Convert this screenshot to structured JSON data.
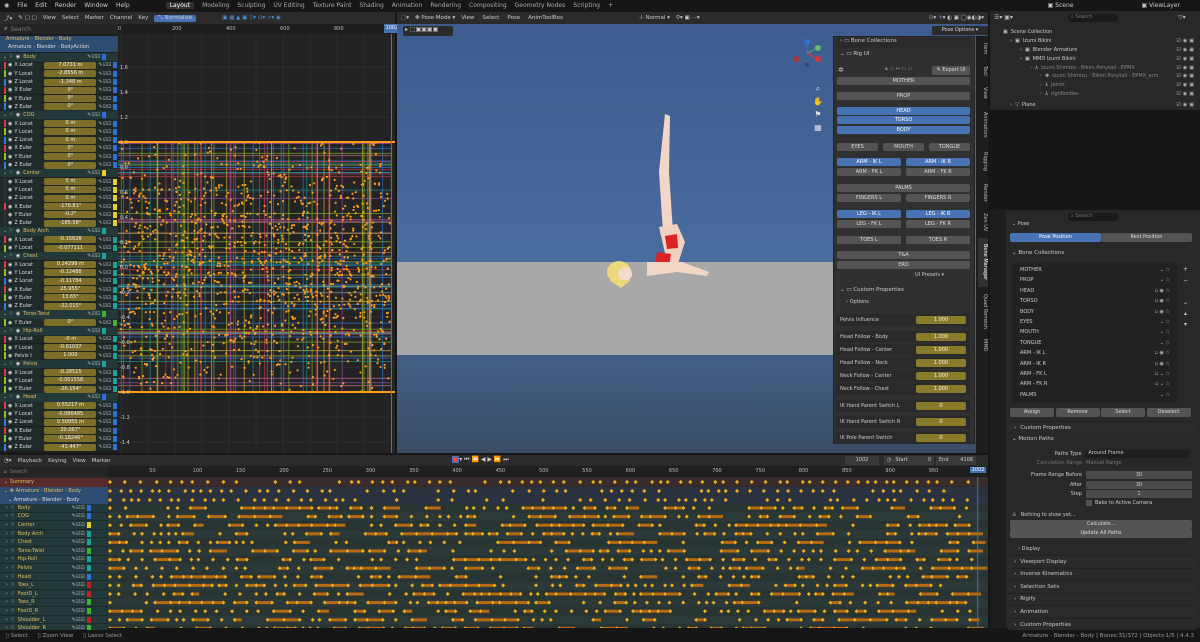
{
  "topbar": {
    "menus": [
      "File",
      "Edit",
      "Render",
      "Window",
      "Help"
    ],
    "workspaces": [
      "Layout",
      "Modeling",
      "Sculpting",
      "UV Editing",
      "Texture Paint",
      "Shading",
      "Animation",
      "Rendering",
      "Compositing",
      "Geometry Nodes",
      "Scripting",
      "+"
    ],
    "active_workspace": "Layout",
    "scene": "Scene",
    "view_layer": "ViewLayer"
  },
  "graph": {
    "header": [
      "View",
      "Select",
      "Marker",
      "Channel",
      "Key"
    ],
    "normalize": "Normalize",
    "search_placeholder": "Search",
    "ruler": [
      "0",
      "200",
      "400",
      "600",
      "800"
    ],
    "current_frame": "1002",
    "yticks": [
      "1.6",
      "1.4",
      "1.2",
      "1.0",
      "0.8",
      "0.6",
      "0.4",
      "0.2",
      "0.0",
      "-0.2",
      "-0.4",
      "-0.6",
      "-0.8",
      "-1.0",
      "-1.2",
      "-1.4"
    ],
    "object": "Armature - Blender - Body",
    "action": "Armature - Blender - BodyAction",
    "channels": [
      {
        "g": "Body",
        "c": "#2f6fd8"
      },
      {
        "n": "X Locat",
        "v": "7.0731 m",
        "a": "x"
      },
      {
        "n": "Y Locat",
        "v": "-2.8556 m",
        "a": "y"
      },
      {
        "n": "Z Locat",
        "v": "-1.348 m",
        "a": "z"
      },
      {
        "n": "X Euler",
        "v": "0°",
        "a": "x"
      },
      {
        "n": "Y Euler",
        "v": "0°",
        "a": "y"
      },
      {
        "n": "Z Euler",
        "v": "0°",
        "a": "z"
      },
      {
        "g": "COG",
        "c": "#2f6fd8"
      },
      {
        "n": "X Locat",
        "v": "0 m",
        "a": "x"
      },
      {
        "n": "Y Locat",
        "v": "0 m",
        "a": "y"
      },
      {
        "n": "Z Locat",
        "v": "0 m",
        "a": "z"
      },
      {
        "n": "X Euler",
        "v": "0°",
        "a": "x"
      },
      {
        "n": "Y Euler",
        "v": "0°",
        "a": "y"
      },
      {
        "n": "Z Euler",
        "v": "0°",
        "a": "z"
      },
      {
        "g": "Center",
        "c": "#e6cf2a"
      },
      {
        "n": "X Locat",
        "v": "0 m",
        "a": "d"
      },
      {
        "n": "Y Locat",
        "v": "0 m",
        "a": "d"
      },
      {
        "n": "Z Locat",
        "v": "0 m",
        "a": "d"
      },
      {
        "n": "X Euler",
        "v": "-178.81°",
        "a": "x"
      },
      {
        "n": "Y Euler",
        "v": "-0.2°",
        "a": "d"
      },
      {
        "n": "Z Euler",
        "v": "-185.58°",
        "a": "d"
      },
      {
        "g": "Body Arch",
        "c": "#1aa39a"
      },
      {
        "n": "X Locat",
        "v": "-0.15628",
        "a": "x"
      },
      {
        "n": "Y Locat",
        "v": "-0.077111",
        "a": "y"
      },
      {
        "g": "Chest",
        "c": "#1aa39a"
      },
      {
        "n": "X Locat",
        "v": "0.24299 m",
        "a": "x"
      },
      {
        "n": "Y Locat",
        "v": "-0.12488",
        "a": "y"
      },
      {
        "n": "Z Locat",
        "v": "-0.11784",
        "a": "z"
      },
      {
        "n": "X Euler",
        "v": "25.955°",
        "a": "x"
      },
      {
        "n": "Y Euler",
        "v": "13.65°",
        "a": "y"
      },
      {
        "n": "Z Euler",
        "v": "-22.015°",
        "a": "z"
      },
      {
        "g": "Torso-Twist",
        "c": "#3cb52a"
      },
      {
        "n": "Y Euler",
        "v": "0°",
        "a": "y"
      },
      {
        "g": "Hip-Roll",
        "c": "#1aa39a"
      },
      {
        "n": "X Locat",
        "v": "-0 m",
        "a": "x"
      },
      {
        "n": "Y Locat",
        "v": "-0.61037",
        "a": "y"
      },
      {
        "n": "Pelvis I",
        "v": "1.000",
        "a": "y"
      },
      {
        "g": "Pelvis",
        "c": "#1aa39a"
      },
      {
        "n": "X Locat",
        "v": "-0.28515",
        "a": "x"
      },
      {
        "n": "Y Locat",
        "v": "-0.001558",
        "a": "y"
      },
      {
        "n": "Y Euler",
        "v": "-26.154°",
        "a": "y"
      },
      {
        "g": "Head",
        "c": "#2f6fd8"
      },
      {
        "n": "X Locat",
        "v": "0.55217 m",
        "a": "x"
      },
      {
        "n": "Y Locat",
        "v": "-0.086485",
        "a": "y"
      },
      {
        "n": "Z Locat",
        "v": "0.50955 m",
        "a": "z"
      },
      {
        "n": "X Euler",
        "v": "20.067°",
        "a": "x"
      },
      {
        "n": "Y Euler",
        "v": "-0.18246°",
        "a": "y"
      },
      {
        "n": "Z Euler",
        "v": "-41.447°",
        "a": "z"
      }
    ]
  },
  "viewport": {
    "mode": "Pose Mode",
    "menus": [
      "View",
      "Select",
      "Pose",
      "AnimToolBox"
    ],
    "orientation": "Normal",
    "pose_options": "Pose Options",
    "tabs": [
      "Item",
      "Tool",
      "View",
      "Animation",
      "Rigging",
      "Render",
      "Zen UV",
      "Bone Manager",
      "Quad Remesh",
      "MMD"
    ],
    "sidebar": {
      "bone_collections": "Bone Collections",
      "rig_ui": "Rig UI",
      "export": "Export UI",
      "ui_presets": "UI Presets",
      "buttons": [
        {
          "l": "MOTHER",
          "on": false,
          "row": 0,
          "col": "full"
        },
        {
          "l": "PROP",
          "on": false,
          "row": 1,
          "col": "full"
        },
        {
          "l": "HEAD",
          "on": true,
          "row": 2,
          "col": "full"
        },
        {
          "l": "TORSO",
          "on": true,
          "row": 3,
          "col": "full"
        },
        {
          "l": "BODY",
          "on": true,
          "row": 4,
          "col": "full"
        },
        {
          "l": "EYES",
          "on": false,
          "row": 5,
          "col": "t1"
        },
        {
          "l": "MOUTH",
          "on": false,
          "row": 5,
          "col": "t2"
        },
        {
          "l": "TONGUE",
          "on": false,
          "row": 5,
          "col": "t3"
        },
        {
          "l": "ARM - IK L",
          "on": true,
          "row": 6,
          "col": "l"
        },
        {
          "l": "ARM - IK R",
          "on": true,
          "row": 6,
          "col": "r"
        },
        {
          "l": "ARM - FK L",
          "on": false,
          "row": 7,
          "col": "l"
        },
        {
          "l": "ARM - FK R",
          "on": false,
          "row": 7,
          "col": "r"
        },
        {
          "l": "PALMS",
          "on": false,
          "row": 8,
          "col": "full"
        },
        {
          "l": "FINGERS L",
          "on": false,
          "row": 9,
          "col": "l"
        },
        {
          "l": "FINGERS R",
          "on": false,
          "row": 9,
          "col": "r"
        },
        {
          "l": "LEG - IK L",
          "on": true,
          "row": 10,
          "col": "l"
        },
        {
          "l": "LEG - IK R",
          "on": true,
          "row": 10,
          "col": "r"
        },
        {
          "l": "LEG - FK L",
          "on": false,
          "row": 11,
          "col": "l"
        },
        {
          "l": "LEG - FK R",
          "on": false,
          "row": 11,
          "col": "r"
        },
        {
          "l": "TOES L",
          "on": false,
          "row": 12,
          "col": "l"
        },
        {
          "l": "TOES R",
          "on": false,
          "row": 12,
          "col": "r"
        },
        {
          "l": "T&A",
          "on": false,
          "row": 13,
          "col": "full"
        },
        {
          "l": "ERO",
          "on": false,
          "row": 14,
          "col": "full"
        }
      ],
      "custom_properties": "Custom Properties",
      "options": "Options",
      "props": [
        {
          "l": "Pelvis Influence",
          "v": "1.000"
        },
        {
          "l": "Head Follow - Body",
          "v": "1.000"
        },
        {
          "l": "Head Follow - Center",
          "v": "1.000"
        },
        {
          "l": "Head Follow - Neck",
          "v": "1.000"
        },
        {
          "l": "Neck Follow - Center",
          "v": "1.000"
        },
        {
          "l": "Neck Follow - Chest",
          "v": "1.000"
        },
        {
          "l": "IK Hand Parent Switch L",
          "v": "0"
        },
        {
          "l": "IK Hand Parent Switch R",
          "v": "0"
        },
        {
          "l": "IK Pole Parent Switch",
          "v": "0"
        }
      ]
    }
  },
  "outliner": {
    "search_placeholder": "Search",
    "items": [
      {
        "l": "Scene Collection",
        "d": 0
      },
      {
        "l": "Izumi Bikini",
        "d": 1
      },
      {
        "l": "Blender Armature",
        "d": 2
      },
      {
        "l": "MMD Izumi Bikini",
        "d": 2
      },
      {
        "l": "Izumi Shimizu - Bikini Ponytail - EPMX",
        "d": 3
      },
      {
        "l": "Izumi Shimizu - Bikini Ponytail - EPMX_arm",
        "d": 4
      },
      {
        "l": "joints",
        "d": 4
      },
      {
        "l": "rigidbodies",
        "d": 4
      },
      {
        "l": "Plane",
        "d": 1
      }
    ]
  },
  "properties": {
    "search_placeholder": "Search",
    "pose": "Pose",
    "pose_position": "Pose Position",
    "rest_position": "Rest Position",
    "bone_collections": "Bone Collections",
    "collections": [
      "MOTHER",
      "PROP",
      "HEAD",
      "TORSO",
      "BODY",
      "EYES",
      "MOUTH",
      "TONGUE",
      "ARM - IK L",
      "ARM - IK R",
      "ARM - FK L",
      "ARM - FK R",
      "PALMS"
    ],
    "actions": [
      "Assign",
      "Remove",
      "Select",
      "Deselect"
    ],
    "custom_properties": "Custom Properties",
    "motion_paths": "Motion Paths",
    "paths_type_label": "Paths Type",
    "paths_type": "Around Frame",
    "calc_range_label": "Calculation Range",
    "calc_range": "Manual Range",
    "frame_before_label": "Frame Range Before",
    "frame_before": "30",
    "after_label": "After",
    "after": "30",
    "step_label": "Step",
    "step": "1",
    "bake": "Bake to Active Camera",
    "nothing": "Nothing to show yet...",
    "calculate": "Calculate...",
    "update": "Update All Paths",
    "display": "Display",
    "sections": [
      "Viewport Display",
      "Inverse Kinematics",
      "Selection Sets",
      "Rigify",
      "Animation",
      "Custom Properties"
    ]
  },
  "dopesheet": {
    "menus": [
      "Playback",
      "Keying",
      "View",
      "Marker"
    ],
    "search_placeholder": "Search",
    "frame": "1002",
    "start_label": "Start",
    "start": "0",
    "end_label": "End",
    "end": "4108",
    "ruler": [
      "50",
      "100",
      "150",
      "200",
      "250",
      "300",
      "350",
      "400",
      "450",
      "500",
      "550",
      "600",
      "650",
      "700",
      "750",
      "800",
      "850",
      "900",
      "950"
    ],
    "current": "1002",
    "summary": "Summary",
    "object": "Armature - Blender - Body",
    "action": "Armature - Blender - Body",
    "channels": [
      {
        "l": "Body",
        "c": "#2f6fd8"
      },
      {
        "l": "COG",
        "c": "#2f6fd8"
      },
      {
        "l": "Center",
        "c": "#e6cf2a"
      },
      {
        "l": "Body Arch",
        "c": "#1aa39a"
      },
      {
        "l": "Chest",
        "c": "#1aa39a"
      },
      {
        "l": "Torso-Twist",
        "c": "#3cb52a"
      },
      {
        "l": "Hip-Roll",
        "c": "#1aa39a"
      },
      {
        "l": "Pelvis",
        "c": "#1aa39a"
      },
      {
        "l": "Head",
        "c": "#2f6fd8"
      },
      {
        "l": "Toes_L",
        "c": "#c81e1e"
      },
      {
        "l": "FootD_L",
        "c": "#c81e1e"
      },
      {
        "l": "Toes_R",
        "c": "#3cb52a"
      },
      {
        "l": "FootD_R",
        "c": "#3cb52a"
      },
      {
        "l": "Shoulder_L",
        "c": "#c81e1e"
      },
      {
        "l": "Shoulder_R",
        "c": "#3cb52a"
      }
    ]
  },
  "status": {
    "hints": [
      "Select",
      "Zoom View",
      "Lasso Select"
    ],
    "info": "Armature - Blender - Body | Bones:31/372 | Objects:1/5 | 4.4.3"
  }
}
